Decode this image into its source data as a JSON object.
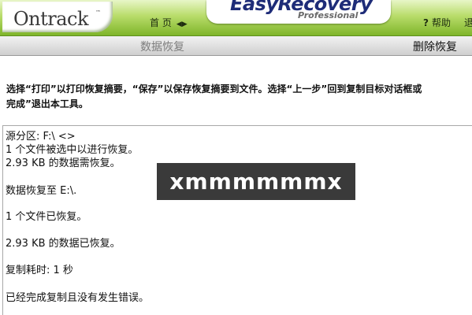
{
  "header": {
    "logo": "Ontrack",
    "logo_tm": "™",
    "home_label": "首 页",
    "home_symbol": "◀▶",
    "product_title": "EasyRecovery",
    "product_edition": "Professional",
    "help_icon": "?",
    "help_label": "帮助",
    "exit_label_partial": "退"
  },
  "titlebar": {
    "section": "数据恢复",
    "current_tool": "删除恢复"
  },
  "instructions": {
    "line1": "选择“打印”以打印恢复摘要，“保存”以保存恢复摘要到文件。选择“上一步”回到复制目标对话框或",
    "line2": "完成”退出本工具。"
  },
  "results": {
    "lines": [
      "源分区: F:\\ <>",
      "1 个文件被选中以进行恢复。",
      "2.93 KB 的数据需恢复。",
      "数据恢复至 E:\\.",
      "1 个文件已恢复。",
      "2.93 KB 的数据已恢复。",
      "复制耗时: 1 秒",
      "已经完成复制且没有发生错误。"
    ]
  },
  "watermark": {
    "text": "xmmmmmmx"
  }
}
